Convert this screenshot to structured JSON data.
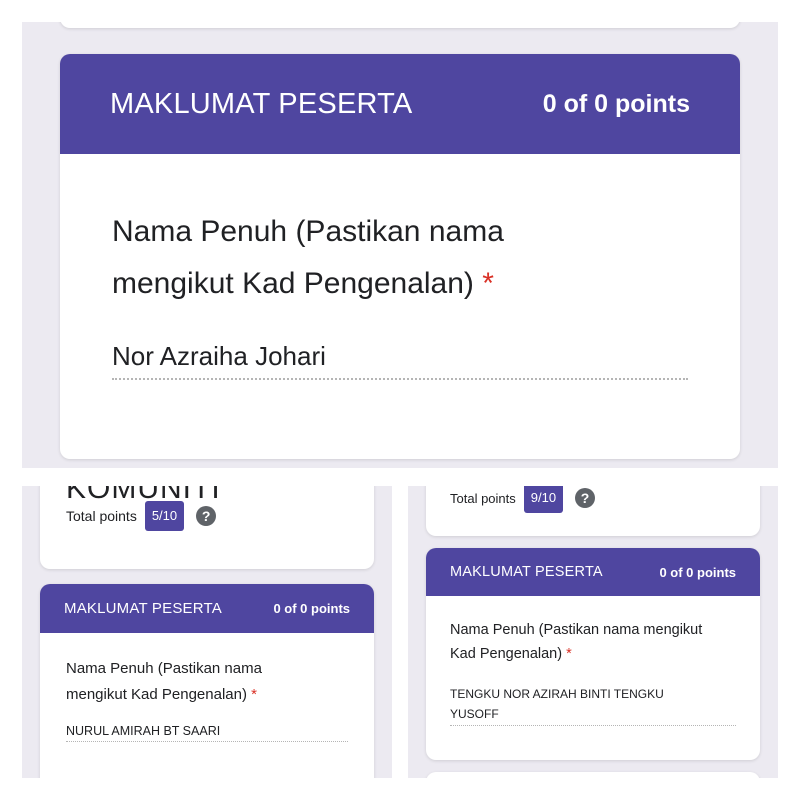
{
  "top_panel": {
    "section_title": "MAKLUMAT PESERTA",
    "section_points": "0 of 0 points",
    "question_line1": "Nama Penuh (Pastikan nama",
    "question_line2": "mengikut Kad Pengenalan)",
    "required_marker": "*",
    "answer": "Nor Azraiha Johari"
  },
  "bottom_left": {
    "cut_heading": "KOMUNITI",
    "total_points_label": "Total points",
    "score": "5/10",
    "help_icon": "?",
    "section_title": "MAKLUMAT PESERTA",
    "section_points": "0 of 0 points",
    "question_line1": "Nama Penuh (Pastikan nama",
    "question_line2": "mengikut Kad Pengenalan)",
    "required_marker": "*",
    "answer": "NURUL AMIRAH BT SAARI"
  },
  "bottom_right": {
    "total_points_label": "Total points",
    "score": "9/10",
    "help_icon": "?",
    "section_title": "MAKLUMAT PESERTA",
    "section_points": "0 of 0 points",
    "question_line1": "Nama Penuh (Pastikan nama mengikut",
    "question_line2": "Kad Pengenalan)",
    "required_marker": "*",
    "answer_line1": "TENGKU NOR AZIRAH BINTI TENGKU",
    "answer_line2": "YUSOFF"
  },
  "colors": {
    "header_purple": "#4f46a0",
    "panel_background": "#eceaf1",
    "required_red": "#d93025",
    "help_icon_gray": "#5f6368"
  }
}
